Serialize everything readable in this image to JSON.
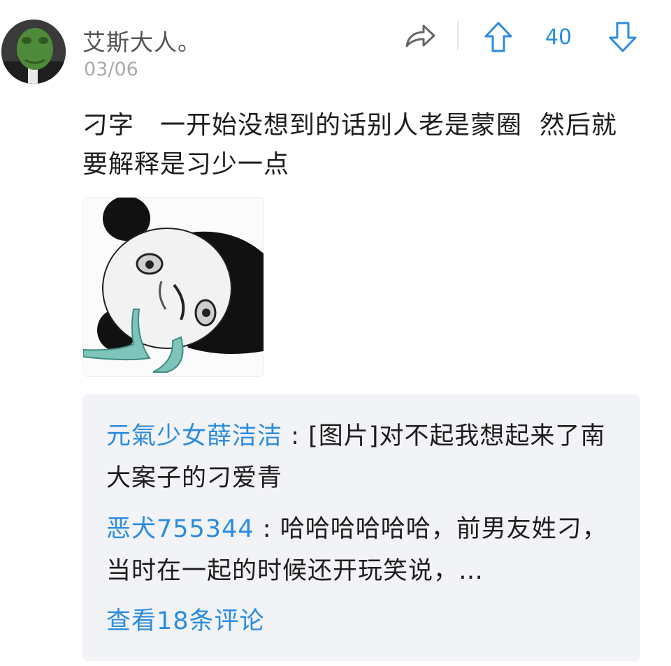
{
  "post": {
    "username": "艾斯大人。",
    "date": "03/06",
    "score": "40",
    "text": "刁字　一开始没想到的话别人老是蒙圈  然后就要解释是习少一点",
    "image_alt": "panda-meme-sticker"
  },
  "actions": {
    "share_icon": "share-arrow-icon",
    "upvote_icon": "upvote-arrow-icon",
    "downvote_icon": "downvote-arrow-icon"
  },
  "comments": [
    {
      "user": "元氣少女薛洁洁",
      "sep": ":",
      "text": "[图片]对不起我想起来了南大案子的刁爱青"
    },
    {
      "user": "恶犬755344",
      "sep": ":",
      "text": "哈哈哈哈哈哈，前男友姓刁，当时在一起的时候还开玩笑说，…"
    }
  ],
  "view_more": "查看18条评论",
  "colors": {
    "accent": "#2a8ce0",
    "username": "#555555",
    "date": "#aaaaaa",
    "comment_bg": "#f2f3f6"
  }
}
